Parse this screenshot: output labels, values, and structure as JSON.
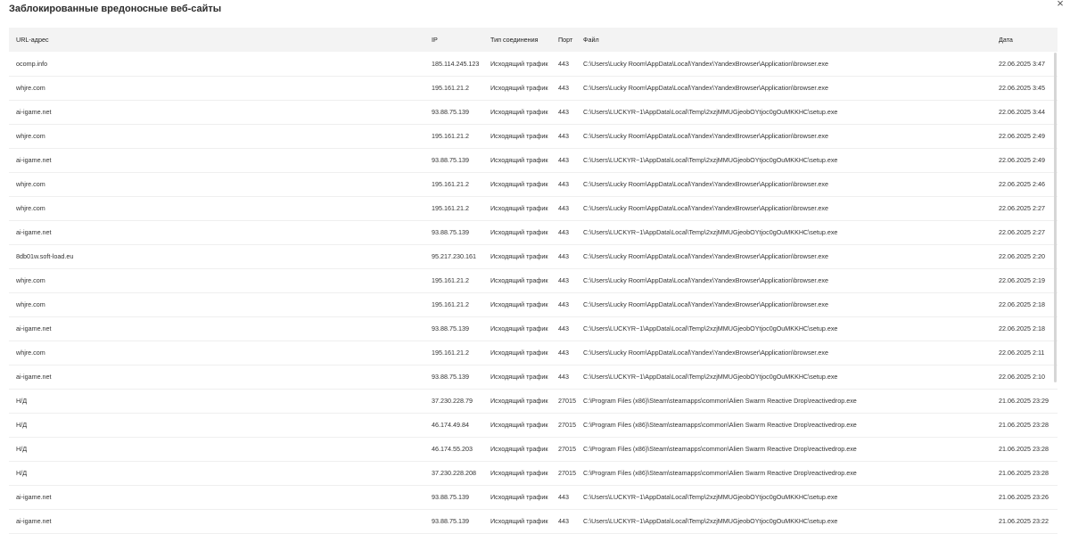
{
  "window": {
    "title": "Заблокированные вредоносные веб-сайты",
    "close_glyph": "×"
  },
  "table": {
    "columns": [
      "URL-адрес",
      "IP",
      "Тип соединения",
      "Порт",
      "Файл",
      "Дата"
    ],
    "rows": [
      [
        "ocomp.info",
        "185.114.245.123",
        "Исходящий трафик",
        "443",
        "C:\\Users\\Lucky Room\\AppData\\Local\\Yandex\\YandexBrowser\\Application\\browser.exe",
        "22.06.2025 3:47"
      ],
      [
        "whjre.com",
        "195.161.21.2",
        "Исходящий трафик",
        "443",
        "C:\\Users\\Lucky Room\\AppData\\Local\\Yandex\\YandexBrowser\\Application\\browser.exe",
        "22.06.2025 3:45"
      ],
      [
        "ai-igame.net",
        "93.88.75.139",
        "Исходящий трафик",
        "443",
        "C:\\Users\\LUCKYR~1\\AppData\\Local\\Temp\\2xzjMMUGjeobOYtjoc0gOuMKKHC\\setup.exe",
        "22.06.2025 3:44"
      ],
      [
        "whjre.com",
        "195.161.21.2",
        "Исходящий трафик",
        "443",
        "C:\\Users\\Lucky Room\\AppData\\Local\\Yandex\\YandexBrowser\\Application\\browser.exe",
        "22.06.2025 2:49"
      ],
      [
        "ai-igame.net",
        "93.88.75.139",
        "Исходящий трафик",
        "443",
        "C:\\Users\\LUCKYR~1\\AppData\\Local\\Temp\\2xzjMMUGjeobOYtjoc0gOuMKKHC\\setup.exe",
        "22.06.2025 2:49"
      ],
      [
        "whjre.com",
        "195.161.21.2",
        "Исходящий трафик",
        "443",
        "C:\\Users\\Lucky Room\\AppData\\Local\\Yandex\\YandexBrowser\\Application\\browser.exe",
        "22.06.2025 2:46"
      ],
      [
        "whjre.com",
        "195.161.21.2",
        "Исходящий трафик",
        "443",
        "C:\\Users\\Lucky Room\\AppData\\Local\\Yandex\\YandexBrowser\\Application\\browser.exe",
        "22.06.2025 2:27"
      ],
      [
        "ai-igame.net",
        "93.88.75.139",
        "Исходящий трафик",
        "443",
        "C:\\Users\\LUCKYR~1\\AppData\\Local\\Temp\\2xzjMMUGjeobOYtjoc0gOuMKKHC\\setup.exe",
        "22.06.2025 2:27"
      ],
      [
        "8db01w.soft-load.eu",
        "95.217.230.161",
        "Исходящий трафик",
        "443",
        "C:\\Users\\Lucky Room\\AppData\\Local\\Yandex\\YandexBrowser\\Application\\browser.exe",
        "22.06.2025 2:20"
      ],
      [
        "whjre.com",
        "195.161.21.2",
        "Исходящий трафик",
        "443",
        "C:\\Users\\Lucky Room\\AppData\\Local\\Yandex\\YandexBrowser\\Application\\browser.exe",
        "22.06.2025 2:19"
      ],
      [
        "whjre.com",
        "195.161.21.2",
        "Исходящий трафик",
        "443",
        "C:\\Users\\Lucky Room\\AppData\\Local\\Yandex\\YandexBrowser\\Application\\browser.exe",
        "22.06.2025 2:18"
      ],
      [
        "ai-igame.net",
        "93.88.75.139",
        "Исходящий трафик",
        "443",
        "C:\\Users\\LUCKYR~1\\AppData\\Local\\Temp\\2xzjMMUGjeobOYtjoc0gOuMKKHC\\setup.exe",
        "22.06.2025 2:18"
      ],
      [
        "whjre.com",
        "195.161.21.2",
        "Исходящий трафик",
        "443",
        "C:\\Users\\Lucky Room\\AppData\\Local\\Yandex\\YandexBrowser\\Application\\browser.exe",
        "22.06.2025 2:11"
      ],
      [
        "ai-igame.net",
        "93.88.75.139",
        "Исходящий трафик",
        "443",
        "C:\\Users\\LUCKYR~1\\AppData\\Local\\Temp\\2xzjMMUGjeobOYtjoc0gOuMKKHC\\setup.exe",
        "22.06.2025 2:10"
      ],
      [
        "Н/Д",
        "37.230.228.79",
        "Исходящий трафик",
        "27015",
        "C:\\Program Files (x86)\\Steam\\steamapps\\common\\Alien Swarm Reactive Drop\\reactivedrop.exe",
        "21.06.2025 23:29"
      ],
      [
        "Н/Д",
        "46.174.49.84",
        "Исходящий трафик",
        "27015",
        "C:\\Program Files (x86)\\Steam\\steamapps\\common\\Alien Swarm Reactive Drop\\reactivedrop.exe",
        "21.06.2025 23:28"
      ],
      [
        "Н/Д",
        "46.174.55.203",
        "Исходящий трафик",
        "27015",
        "C:\\Program Files (x86)\\Steam\\steamapps\\common\\Alien Swarm Reactive Drop\\reactivedrop.exe",
        "21.06.2025 23:28"
      ],
      [
        "Н/Д",
        "37.230.228.208",
        "Исходящий трафик",
        "27015",
        "C:\\Program Files (x86)\\Steam\\steamapps\\common\\Alien Swarm Reactive Drop\\reactivedrop.exe",
        "21.06.2025 23:28"
      ],
      [
        "ai-igame.net",
        "93.88.75.139",
        "Исходящий трафик",
        "443",
        "C:\\Users\\LUCKYR~1\\AppData\\Local\\Temp\\2xzjMMUGjeobOYtjoc0gOuMKKHC\\setup.exe",
        "21.06.2025 23:26"
      ],
      [
        "ai-igame.net",
        "93.88.75.139",
        "Исходящий трафик",
        "443",
        "C:\\Users\\LUCKYR~1\\AppData\\Local\\Temp\\2xzjMMUGjeobOYtjoc0gOuMKKHC\\setup.exe",
        "21.06.2025 23:22"
      ]
    ]
  }
}
